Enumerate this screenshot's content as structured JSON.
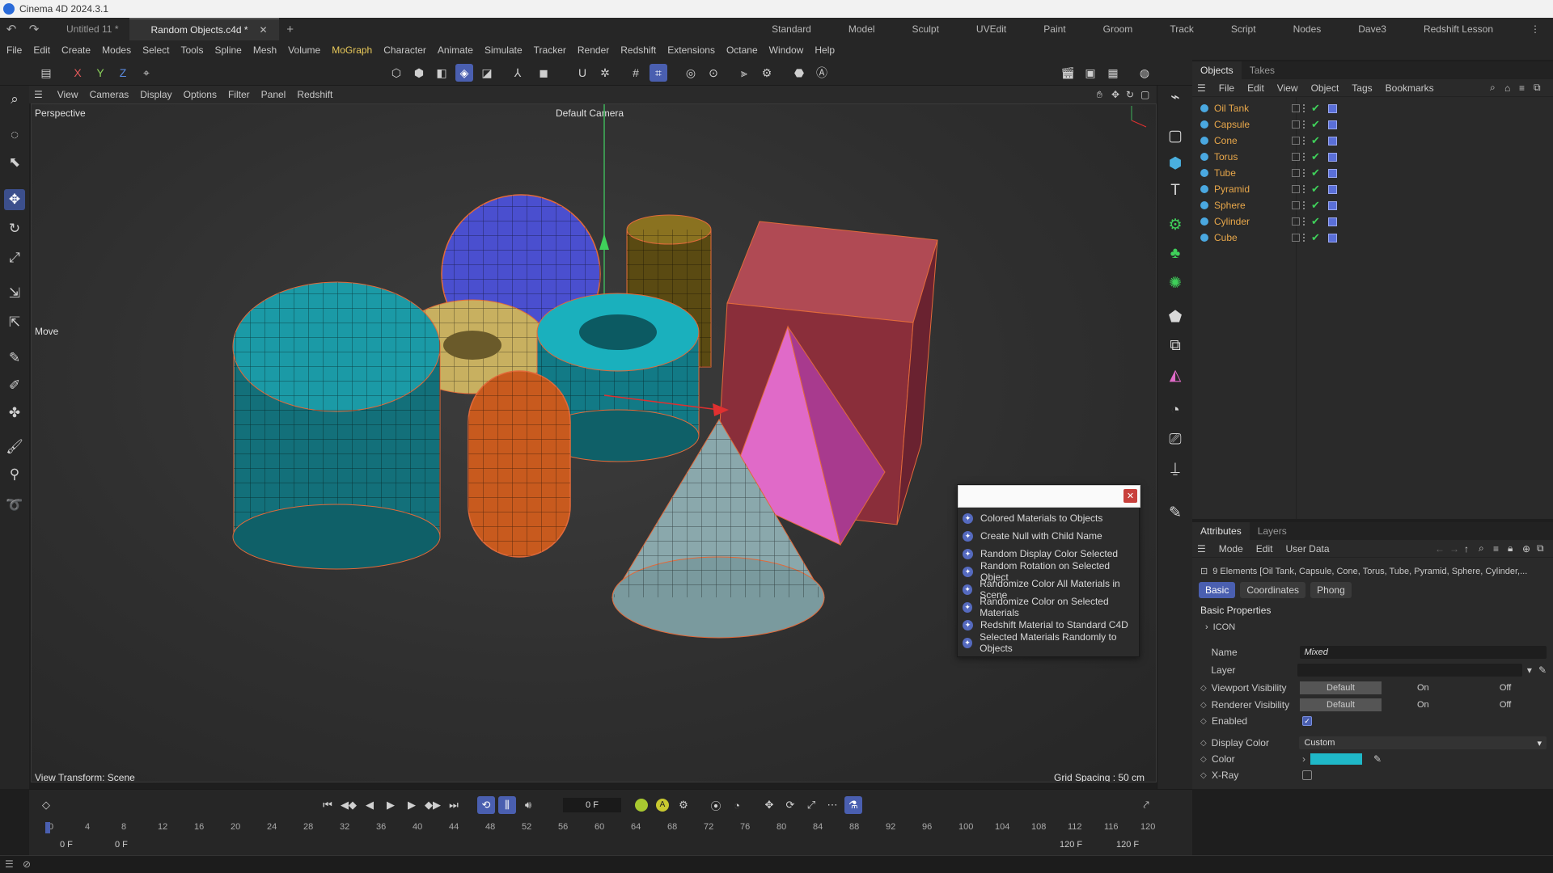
{
  "app": {
    "title": "Cinema 4D 2024.3.1"
  },
  "tabs": [
    {
      "label": "Untitled 11 *"
    },
    {
      "label": "Random Objects.c4d *"
    }
  ],
  "layouts": [
    "Standard",
    "Model",
    "Sculpt",
    "UVEdit",
    "Paint",
    "Groom",
    "Track",
    "Script",
    "Nodes",
    "Dave3",
    "Redshift Lesson"
  ],
  "menu": [
    "File",
    "Edit",
    "Create",
    "Modes",
    "Select",
    "Tools",
    "Spline",
    "Mesh",
    "Volume",
    "MoGraph",
    "Character",
    "Animate",
    "Simulate",
    "Tracker",
    "Render",
    "Redshift",
    "Extensions",
    "Octane",
    "Window",
    "Help"
  ],
  "axes": {
    "x": "X",
    "y": "Y",
    "z": "Z"
  },
  "viewport": {
    "menu": [
      "View",
      "Cameras",
      "Display",
      "Options",
      "Filter",
      "Panel",
      "Redshift"
    ],
    "name": "Perspective",
    "camera": "Default Camera",
    "move_label": "Move",
    "view_transform": "View Transform: Scene",
    "grid_spacing": "Grid Spacing : 50 cm"
  },
  "popup": {
    "search_value": "",
    "items": [
      "Colored Materials to Objects",
      "Create Null with Child Name",
      "Random Display Color Selected",
      "Random Rotation on Selected Object",
      "Randomize Color All Materials in Scene",
      "Randomize Color on Selected Materials",
      "Redshift Material to Standard C4D",
      "Selected Materials Randomly to Objects"
    ]
  },
  "objects_panel": {
    "tabs": [
      "Objects",
      "Takes"
    ],
    "menu": [
      "File",
      "Edit",
      "View",
      "Object",
      "Tags",
      "Bookmarks"
    ],
    "objects": [
      "Oil Tank",
      "Capsule",
      "Cone",
      "Torus",
      "Tube",
      "Pyramid",
      "Sphere",
      "Cylinder",
      "Cube"
    ]
  },
  "attributes_panel": {
    "tabs": [
      "Attributes",
      "Layers"
    ],
    "menu": [
      "Mode",
      "Edit",
      "User Data"
    ],
    "summary": "9 Elements [Oil Tank, Capsule, Cone, Torus, Tube, Pyramid, Sphere, Cylinder,...",
    "subtabs": [
      "Basic",
      "Coordinates",
      "Phong"
    ],
    "section": "Basic Properties",
    "group": "ICON",
    "fields": {
      "name_label": "Name",
      "name_value": "Mixed",
      "layer_label": "Layer",
      "viewport_vis_label": "Viewport Visibility",
      "renderer_vis_label": "Renderer Visibility",
      "vis_options": [
        "Default",
        "On",
        "Off"
      ],
      "enabled_label": "Enabled",
      "display_color_label": "Display Color",
      "display_color_value": "Custom",
      "color_label": "Color",
      "color_value": "#1fb8c8",
      "xray_label": "X-Ray"
    }
  },
  "timeline": {
    "frame_display": "0 F",
    "start_left": "0 F",
    "start_right": "0 F",
    "end_left": "120 F",
    "end_right": "120 F",
    "ticks": [
      "0",
      "4",
      "8",
      "12",
      "16",
      "20",
      "24",
      "28",
      "32",
      "36",
      "40",
      "44",
      "48",
      "52",
      "56",
      "60",
      "64",
      "68",
      "72",
      "76",
      "80",
      "84",
      "88",
      "92",
      "96",
      "100",
      "104",
      "108",
      "112",
      "116",
      "120"
    ]
  }
}
